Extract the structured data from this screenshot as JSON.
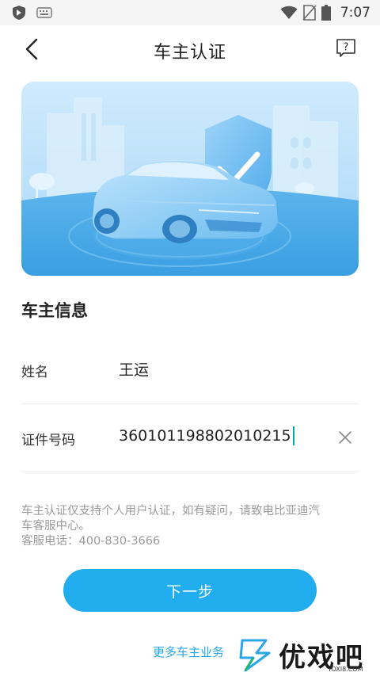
{
  "status_bar": {
    "time": "7:07",
    "icons": [
      "app-shield-icon",
      "keyboard-icon",
      "wifi-icon",
      "no-signal-icon",
      "battery-icon"
    ]
  },
  "header": {
    "title": "车主认证",
    "back_icon": "chevron-left-icon",
    "help_icon": "help-icon",
    "help_glyph": "?"
  },
  "banner": {
    "illustration": "car-with-shield-check",
    "colors": {
      "sky": "#bfe3fb",
      "ground": "#3aa1e4",
      "car": "#8fcdf6",
      "shield": "#66b9ef"
    }
  },
  "section": {
    "title": "车主信息"
  },
  "form": {
    "name_label": "姓名",
    "name_value": "王运",
    "id_label": "证件号码",
    "id_value": "360101198802010215",
    "clear_icon": "close-icon"
  },
  "notice": {
    "line1": "车主认证仅支持个人用户认证，如有疑问，请致电比亚迪汽",
    "line2": "车客服中心。",
    "line3": "客服电话：400-830-3666"
  },
  "actions": {
    "next_label": "下一步",
    "more_label": "更多车主业务"
  },
  "watermark": {
    "text": "优戏吧",
    "url": "YOXI8.COM"
  },
  "colors": {
    "accent": "#22aeee",
    "link": "#2aa6e6"
  }
}
